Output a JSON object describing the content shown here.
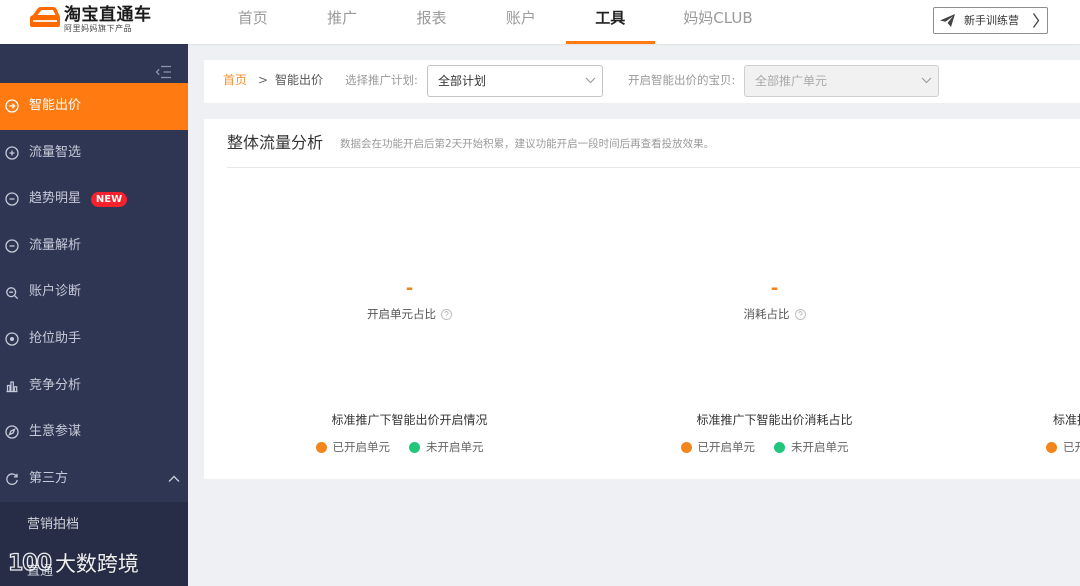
{
  "app": {
    "logo_title": "淘宝直通车",
    "logo_subtitle": "阿里妈妈旗下产品",
    "logo_icon": "car-icon"
  },
  "topnav": {
    "items": [
      {
        "label": "首页"
      },
      {
        "label": "推广"
      },
      {
        "label": "报表"
      },
      {
        "label": "账户"
      },
      {
        "label": "工具",
        "active": true
      },
      {
        "label": "妈妈CLUB"
      }
    ],
    "training_button": "新手训练营",
    "training_icon": "paper-plane-icon"
  },
  "sidebar": {
    "collapse_icon": "menu-collapse-icon",
    "items": [
      {
        "label": "智能出价",
        "icon": "circle-arrow-icon",
        "active": true
      },
      {
        "label": "流量智选",
        "icon": "circle-plus-icon"
      },
      {
        "label": "趋势明星",
        "icon": "circle-minus-icon",
        "badge": "NEW"
      },
      {
        "label": "流量解析",
        "icon": "circle-minus-icon"
      },
      {
        "label": "账户诊断",
        "icon": "magnifier-icon"
      },
      {
        "label": "抢位助手",
        "icon": "target-icon"
      },
      {
        "label": "竞争分析",
        "icon": "bar-chart-icon"
      },
      {
        "label": "生意参谋",
        "icon": "compass-icon"
      },
      {
        "label": "第三方",
        "icon": "refresh-icon",
        "expanded": true
      }
    ],
    "subitems": [
      {
        "label": "营销拍档"
      },
      {
        "label": "直通"
      }
    ]
  },
  "breadcrumb": {
    "home": "首页",
    "separator": ">",
    "current": "智能出价"
  },
  "filters": {
    "plan_label": "选择推广计划:",
    "plan_value": "全部计划",
    "unit_label": "开启智能出价的宝贝:",
    "unit_value": "全部推广单元",
    "unit_disabled": true
  },
  "analysis": {
    "title": "整体流量分析",
    "note": "数据会在功能开启后第2天开始积累，建议功能开启一段时间后再查看投放效果。",
    "columns": [
      {
        "value": "-",
        "metric": "开启单元占比",
        "chart_title": "标准推广下智能出价开启情况",
        "legend": [
          "已开启单元",
          "未开启单元"
        ]
      },
      {
        "value": "-",
        "metric": "消耗占比",
        "chart_title": "标准推广下智能出价消耗占比",
        "legend": [
          "已开启单元",
          "未开启单元"
        ]
      },
      {
        "chart_title": "标准推",
        "legend": [
          "已开"
        ]
      }
    ]
  },
  "watermark": {
    "brand": "100",
    "text": "大数跨境"
  },
  "colors": {
    "accent": "#ff7b12",
    "accent_soft": "#f7923a",
    "sidebar_bg": "#2f3654",
    "sidebar_sub_bg": "#272d46",
    "badge": "#f5222d",
    "legend_on": "#f2851c",
    "legend_off": "#22c67b"
  }
}
